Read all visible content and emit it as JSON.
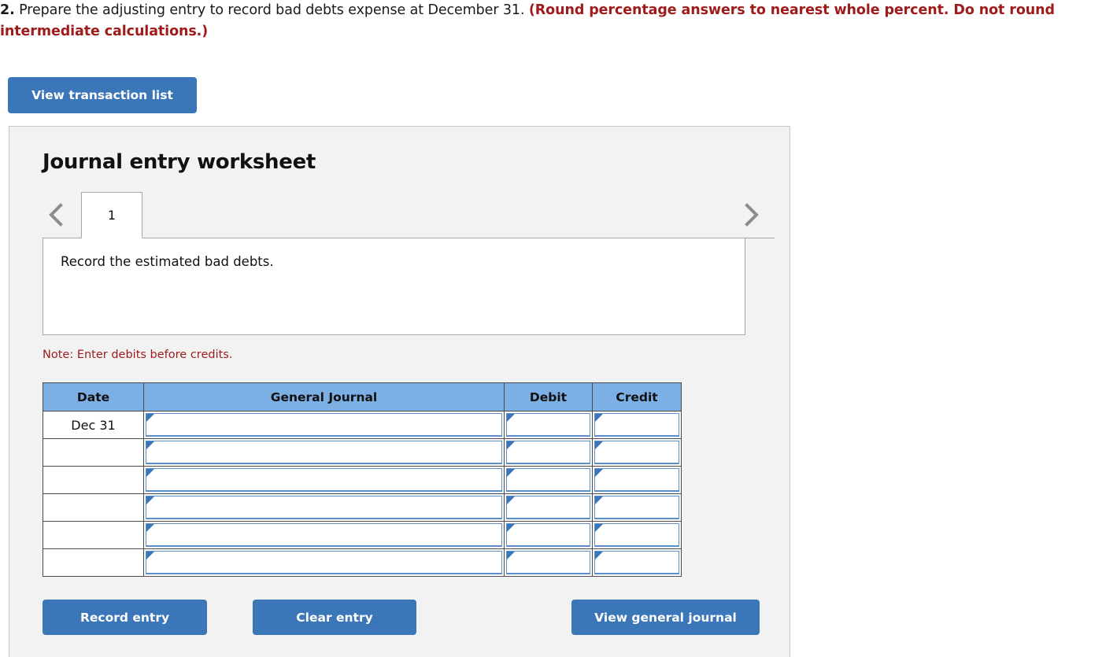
{
  "question": {
    "number": "2.",
    "text_main": " Prepare the adjusting entry to record bad debts expense at December 31. ",
    "text_emphasis": "(Round percentage answers to nearest whole percent. Do not round intermediate calculations.)"
  },
  "toolbar": {
    "view_transaction_list_label": "View transaction list"
  },
  "worksheet": {
    "title": "Journal entry worksheet",
    "prev_icon": "chevron-left-icon",
    "next_icon": "chevron-right-icon",
    "tabs": [
      {
        "label": "1",
        "active": true
      }
    ],
    "description": "Record the estimated bad debts.",
    "note": "Note: Enter debits before credits."
  },
  "table": {
    "headers": [
      "Date",
      "General Journal",
      "Debit",
      "Credit"
    ],
    "rows": [
      {
        "date": "Dec 31",
        "general_journal": "",
        "debit": "",
        "credit": ""
      },
      {
        "date": "",
        "general_journal": "",
        "debit": "",
        "credit": ""
      },
      {
        "date": "",
        "general_journal": "",
        "debit": "",
        "credit": ""
      },
      {
        "date": "",
        "general_journal": "",
        "debit": "",
        "credit": ""
      },
      {
        "date": "",
        "general_journal": "",
        "debit": "",
        "credit": ""
      },
      {
        "date": "",
        "general_journal": "",
        "debit": "",
        "credit": ""
      }
    ]
  },
  "footer": {
    "record_entry_label": "Record entry",
    "clear_entry_label": "Clear entry",
    "view_general_journal_label": "View general journal"
  },
  "colors": {
    "accent_blue": "#3b76b8",
    "header_blue": "#7cafe4",
    "alert_red": "#9e1b1b",
    "panel_bg": "#f2f2f2",
    "panel_border": "#c8c8c8",
    "cell_border_blue": "#5b8fc9"
  }
}
